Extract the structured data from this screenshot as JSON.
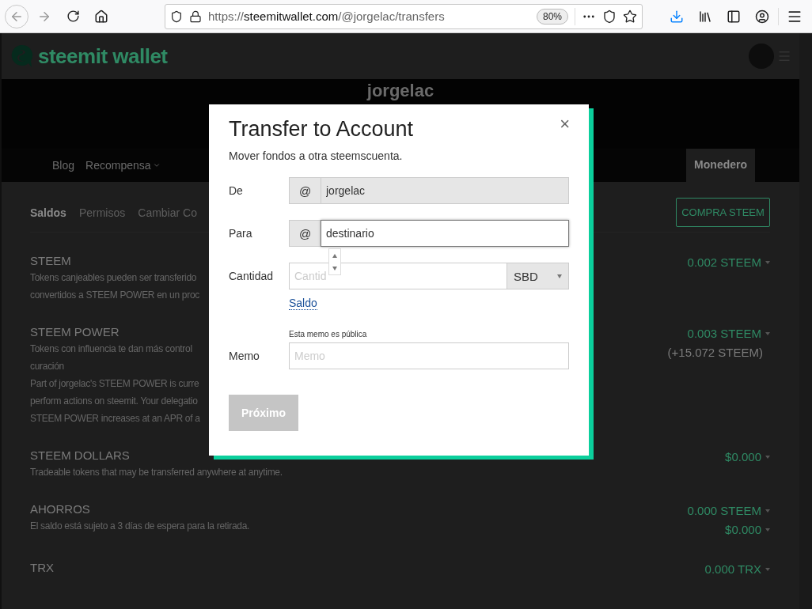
{
  "browser": {
    "url_scheme": "https://",
    "url_host": "steemitwallet.com",
    "url_path": "/@jorgelac/transfers",
    "zoom": "80%"
  },
  "site": {
    "logo": "steemit wallet",
    "username": "jorgelac",
    "nav": [
      {
        "label": "Blog",
        "dropdown": false
      },
      {
        "label": "Recompensa",
        "dropdown": true
      }
    ],
    "wallet_tab": {
      "label": "Monedero",
      "selected": true
    },
    "subtabs": [
      {
        "label": "Saldos",
        "selected": true
      },
      {
        "label": "Permisos",
        "selected": false
      },
      {
        "label": "Cambiar Co",
        "selected": false
      }
    ],
    "buy_button": "COMPRA STEEM"
  },
  "balances": [
    {
      "name": "STEEM",
      "description": [
        "Tokens canjeables pueden ser transferido",
        "convertidos a STEEM POWER en un proc"
      ],
      "amounts": [
        {
          "text": "0.002 STEEM",
          "dropdown": true
        }
      ]
    },
    {
      "name": "STEEM POWER",
      "description": [
        "Tokens con influencia te dan más control",
        "curación",
        "Part of jorgelac's STEEM POWER is curre",
        "perform actions on steemit. Your delegatio",
        "STEEM POWER increases at an APR of a"
      ],
      "amounts": [
        {
          "text": "0.003 STEEM",
          "dropdown": true
        },
        {
          "text": "(+15.072 STEEM)",
          "dropdown": false
        }
      ]
    },
    {
      "name": "STEEM DOLLARS",
      "description": [
        "Tradeable tokens that may be transferred anywhere at anytime."
      ],
      "amounts": [
        {
          "text": "$0.000",
          "dropdown": true
        }
      ]
    },
    {
      "name": "AHORROS",
      "description": [
        "El saldo está sujeto a 3 días de espera para la retirada."
      ],
      "amounts": [
        {
          "text": "0.000 STEEM",
          "dropdown": true
        },
        {
          "text": "$0.000",
          "dropdown": true
        }
      ]
    },
    {
      "name": "TRX",
      "amounts": [
        {
          "text": "0.000 TRX",
          "dropdown": true
        }
      ]
    }
  ],
  "dialog": {
    "title": "Transfer to Account",
    "subtitle": "Mover fondos a otra steemscuenta.",
    "close": "×",
    "fields": [
      {
        "kind": "prefixed",
        "label": "De",
        "prefix": "@",
        "value": "jorgelac",
        "disabled": true,
        "focused": false
      },
      {
        "kind": "prefixed",
        "label": "Para",
        "prefix": "@",
        "value": "destinario",
        "disabled": false,
        "focused": true
      },
      {
        "kind": "amount",
        "label": "Cantidad",
        "placeholder": "Cantid",
        "currency": "SBD",
        "link": "Saldo"
      },
      {
        "kind": "memo",
        "label": "Memo",
        "hint": "Esta memo es pública",
        "placeholder": "Memo"
      }
    ],
    "submit": {
      "label": "Próximo",
      "disabled": true
    }
  }
}
